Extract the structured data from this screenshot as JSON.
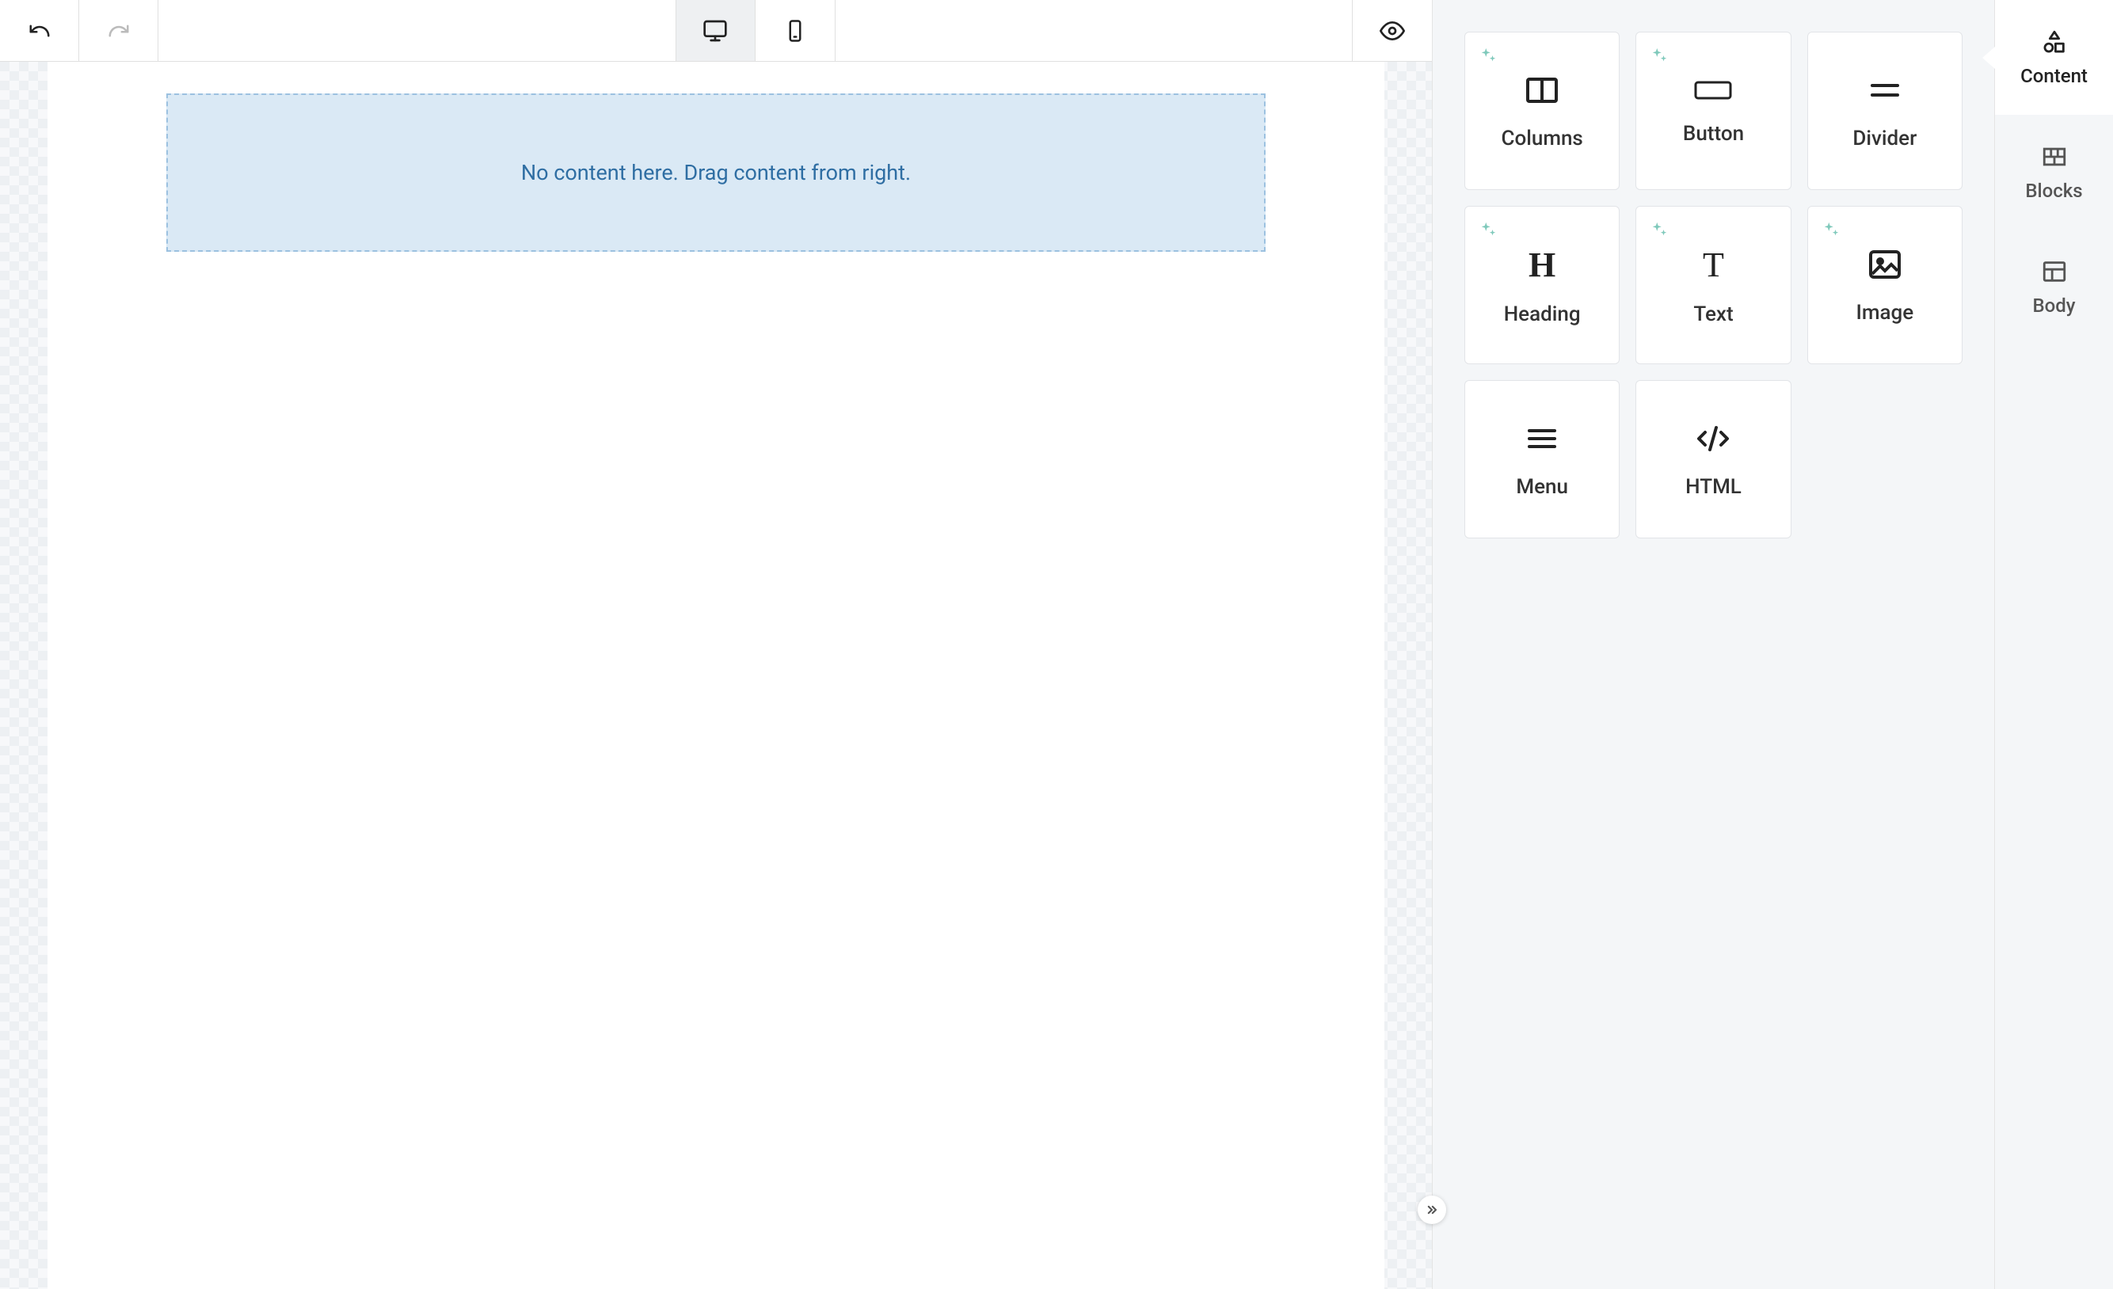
{
  "canvas": {
    "empty_message": "No content here. Drag content from right."
  },
  "blocks": [
    {
      "id": "columns",
      "label": "Columns",
      "sparkle": true
    },
    {
      "id": "button",
      "label": "Button",
      "sparkle": true
    },
    {
      "id": "divider",
      "label": "Divider",
      "sparkle": false
    },
    {
      "id": "heading",
      "label": "Heading",
      "sparkle": true
    },
    {
      "id": "text",
      "label": "Text",
      "sparkle": true
    },
    {
      "id": "image",
      "label": "Image",
      "sparkle": true
    },
    {
      "id": "menu",
      "label": "Menu",
      "sparkle": false
    },
    {
      "id": "html",
      "label": "HTML",
      "sparkle": false
    }
  ],
  "tabs": {
    "content": "Content",
    "blocks": "Blocks",
    "body": "Body"
  }
}
